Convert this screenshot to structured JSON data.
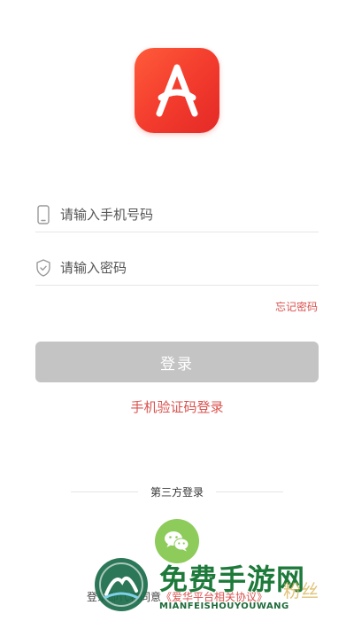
{
  "app": {
    "logo_icon": "letter-a-logo-icon",
    "accent_color": "#f03a2c"
  },
  "phone_field": {
    "placeholder": "请输入手机号码",
    "icon": "phone-icon",
    "value": ""
  },
  "password_field": {
    "placeholder": "请输入密码",
    "icon": "shield-icon",
    "value": ""
  },
  "forgot_label": "忘记密码",
  "login_button_label": "登录",
  "sms_login_label": "手机验证码登录",
  "third_party": {
    "label": "第三方登录",
    "options": [
      {
        "icon": "wechat-icon"
      }
    ]
  },
  "agreement": {
    "prefix": "登录即代表同意",
    "link": "《爱华平台相关协议》"
  },
  "watermark": {
    "title": "免费手游网",
    "subtitle": "MIANFEISHOUYOUWANG",
    "side_text": "粉丝"
  },
  "colors": {
    "link": "#d9534f",
    "button_disabled": "#c4c4c4",
    "wechat": "#8dcb5a"
  }
}
